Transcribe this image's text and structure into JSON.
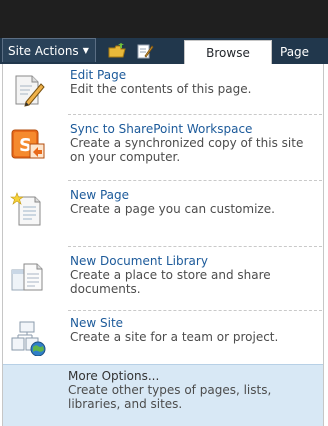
{
  "ribbon": {
    "site_actions_label": "Site Actions",
    "tabs": [
      {
        "label": "Browse"
      },
      {
        "label": "Page"
      }
    ]
  },
  "menu": {
    "items": [
      {
        "title": "Edit Page",
        "description": "Edit the contents of this page.",
        "icon": "edit-page-icon"
      },
      {
        "title": "Sync to SharePoint Workspace",
        "description": "Create a synchronized copy of this site on your computer.",
        "icon": "sharepoint-workspace-icon"
      },
      {
        "title": "New Page",
        "description": "Create a page you can customize.",
        "icon": "new-page-icon"
      },
      {
        "title": "New Document Library",
        "description": "Create a place to store and share documents.",
        "icon": "document-library-icon"
      },
      {
        "title": "New Site",
        "description": "Create a site for a team or project.",
        "icon": "new-site-icon"
      }
    ],
    "more_options": {
      "title": "More Options...",
      "description": "Create other types of pages, lists, libraries, and sites."
    }
  }
}
